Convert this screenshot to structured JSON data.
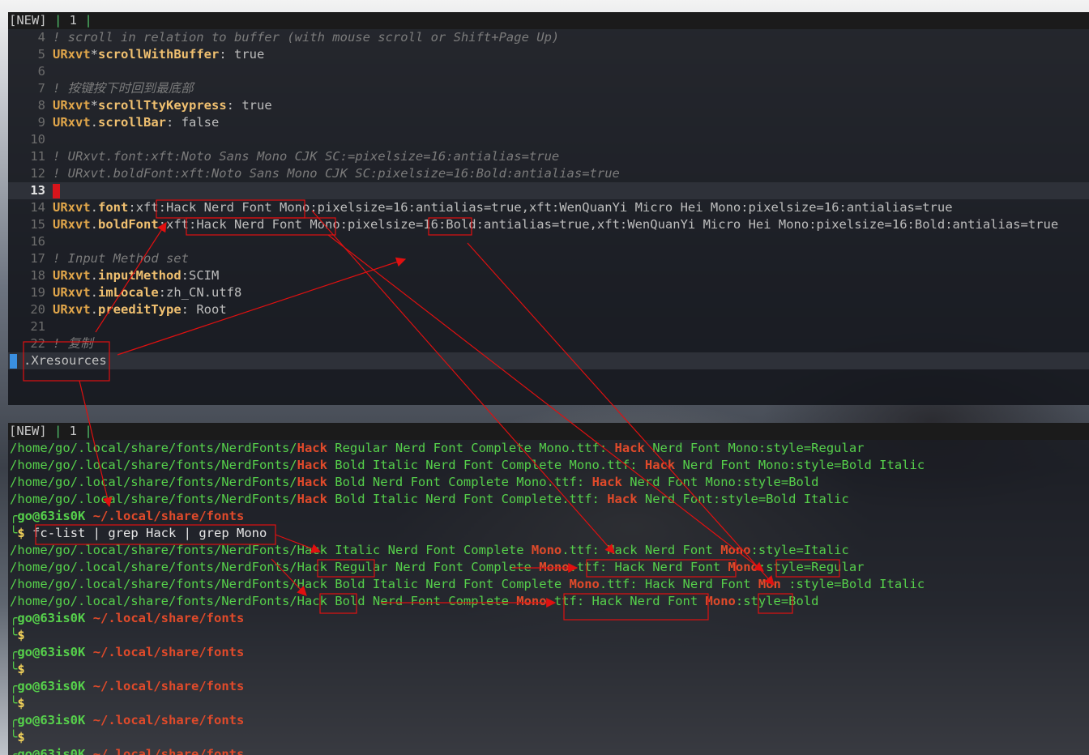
{
  "editor": {
    "status": {
      "mode": "[NEW]",
      "sep1": " | ",
      "buffer": "1",
      "sep2": " |"
    },
    "lines": [
      {
        "n": "4",
        "tokens": [
          {
            "c": "cmt",
            "t": "! scroll in relation to buffer (with mouse scroll or Shift+Page Up)"
          }
        ]
      },
      {
        "n": "5",
        "tokens": [
          {
            "c": "key",
            "t": "URxvt"
          },
          {
            "c": "pun",
            "t": "*"
          },
          {
            "c": "sub",
            "t": "scrollWithBuffer"
          },
          {
            "c": "pun",
            "t": ": "
          },
          {
            "c": "val",
            "t": "true"
          }
        ]
      },
      {
        "n": "6",
        "tokens": []
      },
      {
        "n": "7",
        "tokens": [
          {
            "c": "cmt",
            "t": "! 按键按下时回到最底部"
          }
        ]
      },
      {
        "n": "8",
        "tokens": [
          {
            "c": "key",
            "t": "URxvt"
          },
          {
            "c": "pun",
            "t": "*"
          },
          {
            "c": "sub",
            "t": "scrollTtyKeypress"
          },
          {
            "c": "pun",
            "t": ": "
          },
          {
            "c": "val",
            "t": "true"
          }
        ]
      },
      {
        "n": "9",
        "tokens": [
          {
            "c": "key",
            "t": "URxvt"
          },
          {
            "c": "pun",
            "t": "."
          },
          {
            "c": "sub",
            "t": "scrollBar"
          },
          {
            "c": "pun",
            "t": ": "
          },
          {
            "c": "val",
            "t": "false"
          }
        ]
      },
      {
        "n": "10",
        "tokens": []
      },
      {
        "n": "11",
        "tokens": [
          {
            "c": "cmt",
            "t": "! URxvt.font:xft:Noto Sans Mono CJK SC:=pixelsize=16:antialias=true"
          }
        ]
      },
      {
        "n": "12",
        "tokens": [
          {
            "c": "cmt",
            "t": "! URxvt.boldFont:xft:Noto Sans Mono CJK SC:pixelsize=16:Bold:antialias=true"
          }
        ]
      },
      {
        "n": "13",
        "current": true,
        "tokens": []
      },
      {
        "n": "14",
        "tokens": [
          {
            "c": "key",
            "t": "URxvt"
          },
          {
            "c": "pun",
            "t": "."
          },
          {
            "c": "sub",
            "t": "font"
          },
          {
            "c": "pun",
            "t": ":"
          },
          {
            "c": "val",
            "t": "xft:Hack Nerd Font Mono:pixelsize=16:antialias=true,xft:WenQuanYi Micro Hei Mono:pixelsize=16:antialias=true"
          }
        ]
      },
      {
        "n": "15",
        "tokens": [
          {
            "c": "key",
            "t": "URxvt"
          },
          {
            "c": "pun",
            "t": "."
          },
          {
            "c": "sub",
            "t": "boldFont"
          },
          {
            "c": "pun",
            "t": ":"
          },
          {
            "c": "val",
            "t": "xft:Hack Nerd Font Mono:pixelsize=16:Bold:antialias=true,xft:WenQuanYi Micro Hei Mono:pixelsize=16:Bold:antialias=true"
          }
        ]
      },
      {
        "n": "16",
        "tokens": []
      },
      {
        "n": "17",
        "tokens": [
          {
            "c": "cmt",
            "t": "! Input Method set"
          }
        ]
      },
      {
        "n": "18",
        "tokens": [
          {
            "c": "key",
            "t": "URxvt"
          },
          {
            "c": "pun",
            "t": "."
          },
          {
            "c": "sub",
            "t": "inputMethod"
          },
          {
            "c": "pun",
            "t": ":"
          },
          {
            "c": "val",
            "t": "SCIM"
          }
        ]
      },
      {
        "n": "19",
        "tokens": [
          {
            "c": "key",
            "t": "URxvt"
          },
          {
            "c": "pun",
            "t": "."
          },
          {
            "c": "sub",
            "t": "imLocale"
          },
          {
            "c": "pun",
            "t": ":"
          },
          {
            "c": "val",
            "t": "zh_CN.utf8"
          }
        ]
      },
      {
        "n": "20",
        "tokens": [
          {
            "c": "key",
            "t": "URxvt"
          },
          {
            "c": "pun",
            "t": "."
          },
          {
            "c": "sub",
            "t": "preeditType"
          },
          {
            "c": "pun",
            "t": ": "
          },
          {
            "c": "val",
            "t": "Root"
          }
        ]
      },
      {
        "n": "21",
        "tokens": []
      },
      {
        "n": "22",
        "tokens": [
          {
            "c": "cmt",
            "t": "! 复制"
          }
        ]
      }
    ],
    "filename": ".Xresources"
  },
  "terminal": {
    "status": {
      "mode": "[NEW]",
      "sep1": " | ",
      "buffer": "1",
      "sep2": " |"
    },
    "output_before": [
      [
        {
          "c": "",
          "t": "/home/go/.local/share/fonts/NerdFonts/"
        },
        {
          "c": "hack",
          "t": "Hack"
        },
        {
          "c": "",
          "t": " Regular Nerd Font Complete Mono.ttf: "
        },
        {
          "c": "hack",
          "t": "Hack"
        },
        {
          "c": "",
          "t": " Nerd Font Mono:style=Regular"
        }
      ],
      [
        {
          "c": "",
          "t": "/home/go/.local/share/fonts/NerdFonts/"
        },
        {
          "c": "hack",
          "t": "Hack"
        },
        {
          "c": "",
          "t": " Bold Italic Nerd Font Complete Mono.ttf: "
        },
        {
          "c": "hack",
          "t": "Hack"
        },
        {
          "c": "",
          "t": " Nerd Font Mono:style=Bold Italic"
        }
      ],
      [
        {
          "c": "",
          "t": "/home/go/.local/share/fonts/NerdFonts/"
        },
        {
          "c": "hack",
          "t": "Hack"
        },
        {
          "c": "",
          "t": " Bold Nerd Font Complete Mono.ttf: "
        },
        {
          "c": "hack",
          "t": "Hack"
        },
        {
          "c": "",
          "t": " Nerd Font Mono:style=Bold"
        }
      ],
      [
        {
          "c": "",
          "t": "/home/go/.local/share/fonts/NerdFonts/"
        },
        {
          "c": "hack",
          "t": "Hack"
        },
        {
          "c": "",
          "t": " Bold Italic Nerd Font Complete.ttf: "
        },
        {
          "c": "hack",
          "t": "Hack"
        },
        {
          "c": "",
          "t": " Nerd Font:style=Bold Italic"
        }
      ]
    ],
    "prompt": {
      "user": "go@63is0K",
      "path": "~/.local/share/fonts",
      "dollar": "$"
    },
    "command": "fc-list | grep Hack | grep Mono",
    "output_after": [
      [
        {
          "c": "",
          "t": "/home/go/.local/share/fonts/NerdFonts/Hack Italic Nerd Font Complete "
        },
        {
          "c": "mono",
          "t": "Mono"
        },
        {
          "c": "",
          "t": ".ttf: Hack Nerd Font "
        },
        {
          "c": "mono",
          "t": "Mono"
        },
        {
          "c": "",
          "t": ":style=Italic"
        }
      ],
      [
        {
          "c": "",
          "t": "/home/go/.local/share/fonts/NerdFonts/Hack Regular Nerd Font Complete "
        },
        {
          "c": "mono",
          "t": "Mono"
        },
        {
          "c": "",
          "t": ".ttf: Hack Nerd Font "
        },
        {
          "c": "mono",
          "t": "Mono"
        },
        {
          "c": "",
          "t": ":style=Regular"
        }
      ],
      [
        {
          "c": "",
          "t": "/home/go/.local/share/fonts/NerdFonts/Hack Bold Italic Nerd Font Complete "
        },
        {
          "c": "mono",
          "t": "Mono"
        },
        {
          "c": "",
          "t": ".ttf: Hack Nerd Font "
        },
        {
          "c": "mono",
          "t": "Mon"
        },
        {
          "c": "",
          "t": " :style=Bold Italic"
        }
      ],
      [
        {
          "c": "",
          "t": "/home/go/.local/share/fonts/NerdFonts/Hack Bold Nerd Font Complete "
        },
        {
          "c": "mono",
          "t": "Mono"
        },
        {
          "c": "",
          "t": ".ttf: Hack Nerd Font "
        },
        {
          "c": "mono",
          "t": "Mono"
        },
        {
          "c": "",
          "t": ":style=Bold"
        }
      ]
    ],
    "empty_prompts": 4
  },
  "colors": {
    "annotation": "#e01010",
    "cursor": "#d8141b",
    "prompt_green": "#56d04b",
    "hack_red": "#e04a2a",
    "dollar_yellow": "#f2d25a"
  }
}
